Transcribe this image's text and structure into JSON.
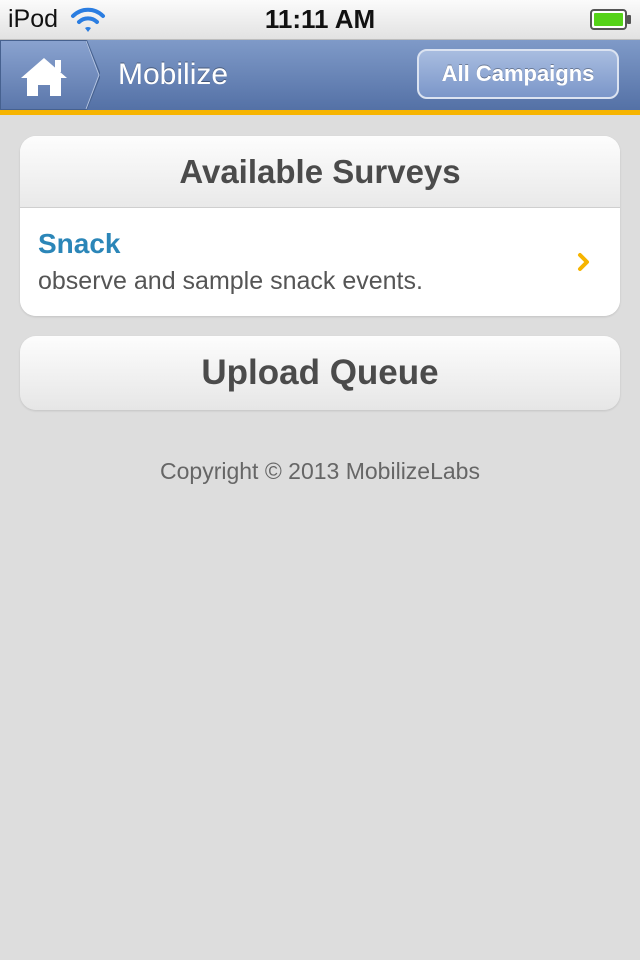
{
  "status_bar": {
    "carrier": "iPod",
    "time": "11:11 AM",
    "icons": [
      "wifi-icon",
      "battery-icon"
    ],
    "battery_color": "#55d219"
  },
  "nav": {
    "home_icon": "home-icon",
    "title": "Mobilize",
    "campaigns_button": "All Campaigns",
    "bar_color": "#5f7cb3",
    "accent_color": "#f6b400"
  },
  "surveys": {
    "header": "Available Surveys",
    "items": [
      {
        "name": "Snack",
        "description": "observe and sample snack events.",
        "icon": "chevron-right-icon",
        "chevron_color": "#f6b400"
      }
    ]
  },
  "upload": {
    "label": "Upload Queue"
  },
  "footer": {
    "copyright": "Copyright © 2013 MobilizeLabs"
  }
}
